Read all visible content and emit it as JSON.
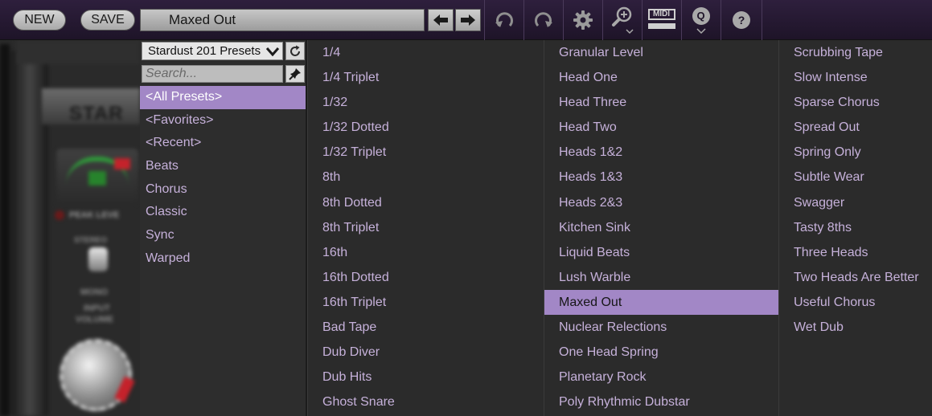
{
  "toolbar": {
    "new_label": "NEW",
    "save_label": "SAVE",
    "preset_name": "Maxed Out",
    "midi_label": "MIDI",
    "q_label": "Q",
    "help_label": "?"
  },
  "sidebar": {
    "bank_name": "Stardust 201 Presets",
    "search_placeholder": "Search...",
    "categories": [
      "<All Presets>",
      "<Favorites>",
      "<Recent>",
      "Beats",
      "Chorus",
      "Classic",
      "Sync",
      "Warped"
    ],
    "selected_category": "<All Presets>"
  },
  "plugin": {
    "brand_fragment": "STAR",
    "peak_label": "PEAK LEVE",
    "stereo_label": "STEREO",
    "mono_label": "MONO",
    "input_label": "INPUT",
    "volume_label": "VOLUME"
  },
  "presets": {
    "columns": [
      [
        "1/4",
        "1/4 Triplet",
        "1/32",
        "1/32 Dotted",
        "1/32 Triplet",
        "8th",
        "8th Dotted",
        "8th Triplet",
        "16th",
        "16th Dotted",
        "16th Triplet",
        "Bad Tape",
        "Dub Diver",
        "Dub Hits",
        "Ghost Snare"
      ],
      [
        "Granular Level",
        "Head One",
        "Head Three",
        "Head Two",
        "Heads 1&2",
        "Heads 1&3",
        "Heads 2&3",
        "Kitchen Sink",
        "Liquid Beats",
        "Lush Warble",
        "Maxed Out",
        "Nuclear Relections",
        "One Head Spring",
        "Planetary Rock",
        "Poly Rhythmic Dubstar"
      ],
      [
        "Scrubbing Tape",
        "Slow Intense",
        "Sparse Chorus",
        "Spread Out",
        "Spring Only",
        "Subtle Wear",
        "Swagger",
        "Tasty 8ths",
        "Three Heads",
        "Two Heads Are Better",
        "Useful Chorus",
        "Wet Dub"
      ]
    ],
    "selected": "Maxed Out"
  },
  "colors": {
    "accent": "#a287c6",
    "list_text": "#c6b1da",
    "toolbar_bg": "#2e1f3d"
  }
}
